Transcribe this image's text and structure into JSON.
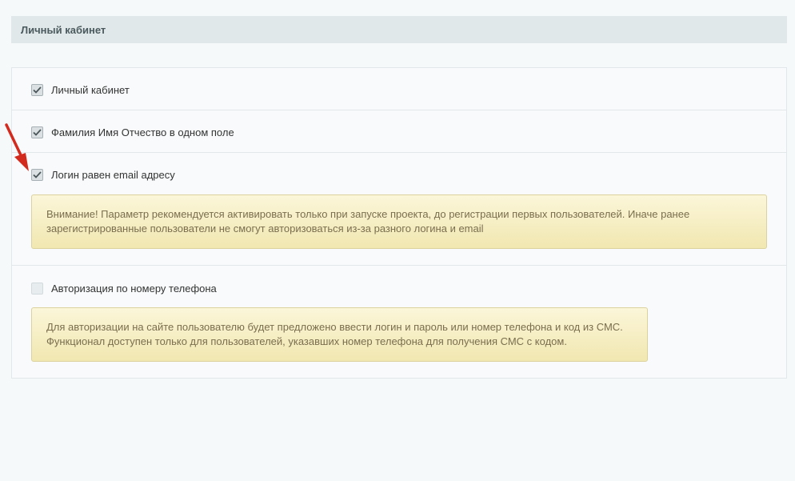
{
  "section": {
    "title": "Личный кабинет"
  },
  "options": [
    {
      "label": "Личный кабинет",
      "checked": true
    },
    {
      "label": "Фамилия Имя Отчество в одном поле",
      "checked": true
    },
    {
      "label": "Логин равен email адресу",
      "checked": true,
      "notice_line1": "Внимание! Параметр рекомендуется активировать только при запуске проекта, до регистрации первых пользователей. Иначе ранее",
      "notice_line2": "зарегистрированные пользователи не смогут авторизоваться из-за разного логина и email"
    },
    {
      "label": "Авторизация по номеру телефона",
      "checked": false,
      "notice_line1": "Для авторизации на сайте пользователю будет предложено ввести логин и пароль или номер телефона и код из СМС.",
      "notice_line2": "Функционал доступен только для пользователей, указавших номер телефона для получения СМС с кодом."
    }
  ],
  "colors": {
    "background": "#f5f9fa",
    "header_bg": "#e0e8ea",
    "notice_bg": "#f6efc6",
    "notice_text": "#7a6e4e",
    "arrow": "#d32a1e"
  },
  "icons": {
    "checkmark": "checkmark-icon",
    "annotation_arrow": "red-arrow-icon"
  }
}
